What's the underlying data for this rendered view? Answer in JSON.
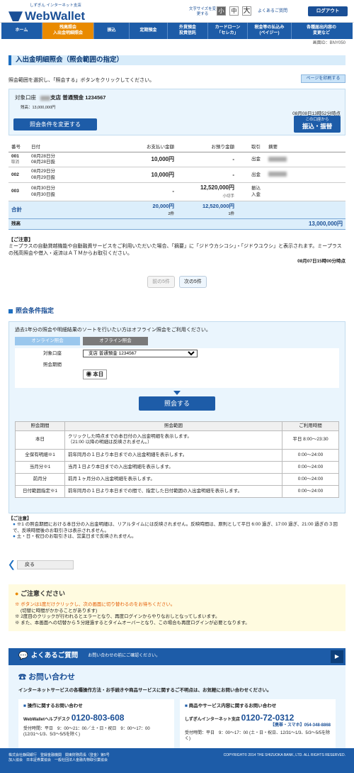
{
  "header": {
    "logo_sub": "しずぎん インターネット支店",
    "logo": "WebWallet",
    "font_size_label": "文字サイズを変更する",
    "font_sizes": [
      "小",
      "中",
      "大"
    ],
    "faq_link": "よくあるご質問",
    "logout": "ログアウト"
  },
  "nav": [
    "ホーム",
    "残高照会\n入出金明細照会",
    "振込",
    "定期預金",
    "外貨預金\n投資信託",
    "カードローン\n「セレカ」",
    "税金等の払込み\n(ペイジー)",
    "各種届出内容の\n変更など"
  ],
  "screen_id": "画面ID：BNY050",
  "page_title": "入出金明細照会（照会範囲の指定）",
  "intro": "照会範囲を選択し、「照会する」ボタンをクリックしてください。",
  "print_button": "ページを印刷する",
  "account": {
    "label": "対象口座",
    "branch": "支店",
    "type": "普通預金",
    "number": "1234567",
    "balance": "残高：13,000,000円",
    "timestamp": "08月08日13時52分時点",
    "change_button": "照会条件を変更する",
    "transfer_line1": "この口座から",
    "transfer_line2": "振込・振替"
  },
  "tx_headers": [
    "番号",
    "日付",
    "お支払い金額",
    "お預り金額",
    "取引",
    "摘要"
  ],
  "transactions": [
    {
      "no": "001",
      "sub": "取消",
      "d1": "08月28日分",
      "d2": "08月28日扱",
      "pay": "10,000円",
      "dep": "-",
      "dep_sub": "",
      "kind": "出金"
    },
    {
      "no": "002",
      "sub": "",
      "d1": "08月29日分",
      "d2": "08月29日扱",
      "pay": "10,000円",
      "dep": "-",
      "dep_sub": "",
      "kind": "出金"
    },
    {
      "no": "003",
      "sub": "",
      "d1": "08月30日分",
      "d2": "08月30日扱",
      "pay": "-",
      "dep": "12,520,000円",
      "dep_sub": "小切手",
      "kind": "振込入金"
    }
  ],
  "totals": {
    "label": "合計",
    "pay": "20,000円",
    "pay_count": "2件",
    "dep": "12,520,000円",
    "dep_count": "1件"
  },
  "balance": {
    "label": "残高",
    "value": "13,000,000円"
  },
  "note": {
    "title": "【ご注意】",
    "text": "ミープラスの自動貸越機能や自動融資サービスをご利用いただいた場合、「摘要」に「ジドウカシコシ」・「ジドウユウシ」と表示されます。ミープラスの残高照会や借入・返済はＡＴＭからお取引ください。",
    "timestamp": "08月07日15時00分時点"
  },
  "pager": {
    "prev": "前の5件",
    "next": "次の5件"
  },
  "cond": {
    "title": "照会条件指定",
    "intro": "過去1年分の照会や明細結果のソートを行いたい方はオフライン照会をご利用ください。",
    "tab_online": "オンライン照会",
    "tab_offline": "オフライン照会",
    "acct_label": "対象口座",
    "acct_value": "支店 普通預金 1234567",
    "period_label": "照会期間",
    "radio": "本日",
    "submit": "照会する"
  },
  "period_headers": [
    "照会期間",
    "照会範囲",
    "ご利用時間"
  ],
  "periods": [
    {
      "n": "本日",
      "r": "クリックした時点までの本日付の入出金明細を表示します。\n（21:00 以降の明細は反映されません。）",
      "t": "平日 8:00～23:30"
    },
    {
      "n": "全保有明細※1",
      "r": "前年同月の１日より本日までの入出金明細を表示します。",
      "t": "0:00～24:00"
    },
    {
      "n": "当月分※1",
      "r": "当月１日より本日までの入出金明細を表示します。",
      "t": "0:00～24:00"
    },
    {
      "n": "前月分",
      "r": "前月１ヶ月分の入出金明細を表示します。",
      "t": "0:00～24:00"
    },
    {
      "n": "日付範囲指定※1",
      "r": "前年同月の１日より本日までの間で、指定した日付範囲の入出金明細を表示します。",
      "t": "0:00～24:00"
    }
  ],
  "cnote": {
    "title": "【ご注意】",
    "items": [
      "※1 の照会期間における本日分の入出金明細は、リアルタイムには反映されません。反映時間は、原則として平日 6:00 過ぎ、17:00 過ぎ、21:00 過ぎの３回で、反映時間後のお取引きは表示されません。",
      "土・日・祝日のお取引きは、営業日まで反映されません。"
    ]
  },
  "back": "戻る",
  "warn": {
    "title": "ご注意ください",
    "l1": "※ ボタンは1度だけクリックし、次の画面に切り替わるのをお待ちください。",
    "l2": "(切替に時間がかかることがあります)",
    "l3": "※ 2度目のクリックが行われるとエラーとなり、再度ログインからやりなおしとなってしまいます。",
    "l4": "※ また、本画面への切替から５分経過するとタイムオーバーとなり、この場合も再度ログインが必要となります。"
  },
  "faq": {
    "title": "よくあるご質問",
    "sub": "お問い合わせの前にご確認ください。"
  },
  "contact": {
    "title": "お問い合わせ",
    "desc": "インターネットサービスの各種操作方法・お手続きや商品サービスに関するご不明点は、お気軽にお問い合わせください。",
    "c1_title": "操作に関するお問い合わせ",
    "c1_name": "WebWalletヘルプデスク",
    "c1_num": "0120-803-608",
    "c1_hours": "受付時間：平日　9：00～21：00／土・日・祝日　9：00～17：00",
    "c1_hours2": "(12/31～1/3、5/3～5/5を除く)",
    "c2_title": "商品やサービス内容に関するお問い合わせ",
    "c2_name": "しずぎんインターネット支店",
    "c2_num": "0120-72-0312",
    "c2_mobile": "【携帯・スマホ】054-348-8868",
    "c2_hours": "受付時間：平日　9：00～17：00 (土・日・祝日、12/31～1/3、5/3～5/5を除く)"
  },
  "footer": {
    "l1": "株式会社静岡銀行　登録金融機関　関東財務局長（登金）第5号",
    "l2": "加入協会　日本証券業協会　一般社団法人金融先物取引業協会",
    "copy": "COPYRIGHT© 2014 THE SHIZUOKA BANK, LTD. ALL RIGHTS RESERVED."
  }
}
